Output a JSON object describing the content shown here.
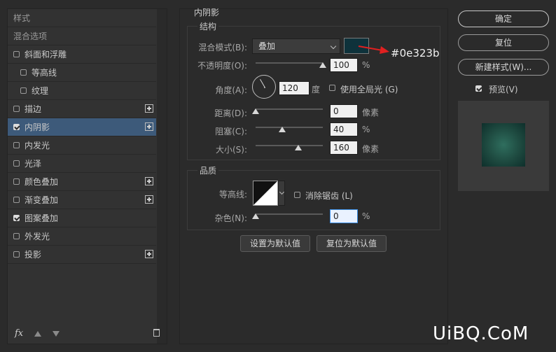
{
  "styles_panel": {
    "header_styles": "样式",
    "header_blend": "混合选项",
    "items": [
      {
        "label": "斜面和浮雕",
        "checked": false,
        "plus": false,
        "indent": 0
      },
      {
        "label": "等高线",
        "checked": false,
        "plus": false,
        "indent": 1
      },
      {
        "label": "纹理",
        "checked": false,
        "plus": false,
        "indent": 1
      },
      {
        "label": "描边",
        "checked": false,
        "plus": true,
        "indent": 0
      },
      {
        "label": "内阴影",
        "checked": true,
        "plus": true,
        "indent": 0,
        "selected": true
      },
      {
        "label": "内发光",
        "checked": false,
        "plus": false,
        "indent": 0
      },
      {
        "label": "光泽",
        "checked": false,
        "plus": false,
        "indent": 0
      },
      {
        "label": "颜色叠加",
        "checked": false,
        "plus": true,
        "indent": 0
      },
      {
        "label": "渐变叠加",
        "checked": false,
        "plus": true,
        "indent": 0
      },
      {
        "label": "图案叠加",
        "checked": true,
        "plus": false,
        "indent": 0
      },
      {
        "label": "外发光",
        "checked": false,
        "plus": false,
        "indent": 0
      },
      {
        "label": "投影",
        "checked": false,
        "plus": true,
        "indent": 0
      }
    ],
    "footer_fx": "fx"
  },
  "inner_shadow": {
    "title": "内阴影",
    "structure": {
      "legend": "结构",
      "blend_mode_label": "混合模式(B):",
      "blend_mode_value": "叠加",
      "color_hex": "#0e323b",
      "color_annotation": "#0e323b",
      "opacity_label": "不透明度(O):",
      "opacity_value": "100",
      "opacity_fraction": 1.0,
      "opacity_unit": "%",
      "angle_label": "角度(A):",
      "angle_value": "120",
      "angle_unit": "度",
      "global_light_label": "使用全局光 (G)",
      "global_light_checked": false,
      "distance_label": "距离(D):",
      "distance_value": "0",
      "distance_fraction": 0.0,
      "distance_unit": "像素",
      "choke_label": "阻塞(C):",
      "choke_value": "40",
      "choke_fraction": 0.4,
      "choke_unit": "%",
      "size_label": "大小(S):",
      "size_value": "160",
      "size_fraction": 0.64,
      "size_unit": "像素"
    },
    "quality": {
      "legend": "品质",
      "contour_label": "等高线:",
      "anti_alias_label": "消除锯齿 (L)",
      "anti_alias_checked": false,
      "noise_label": "杂色(N):",
      "noise_value": "0",
      "noise_fraction": 0.0,
      "noise_unit": "%"
    },
    "set_default_label": "设置为默认值",
    "reset_default_label": "复位为默认值"
  },
  "right_panel": {
    "ok_label": "确定",
    "reset_label": "复位",
    "new_style_label": "新建样式(W)...",
    "preview_label": "预览(V)",
    "preview_checked": true
  },
  "watermark": "UiBQ.CoM"
}
